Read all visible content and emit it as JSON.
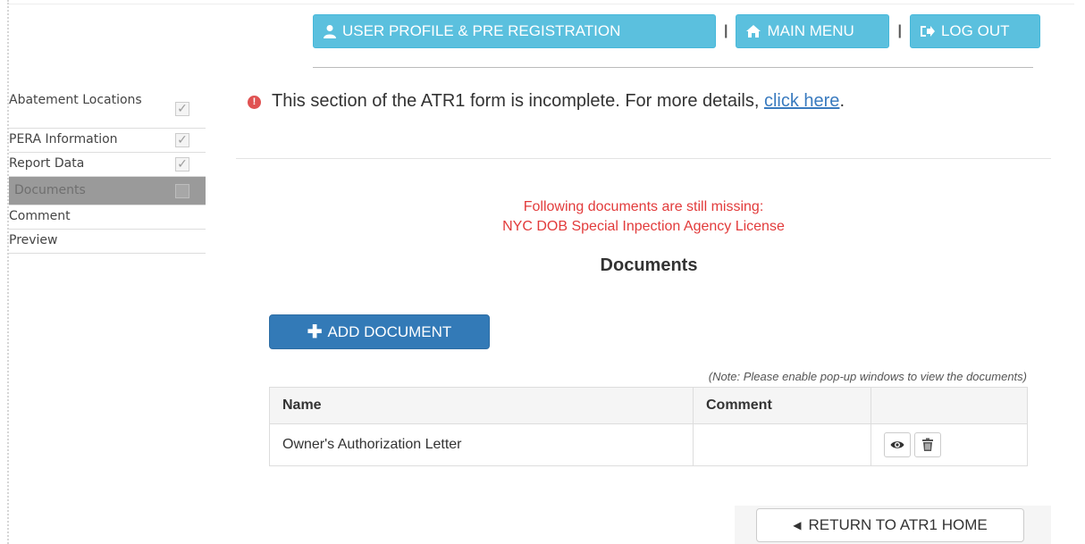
{
  "nav": {
    "profile_label": "USER PROFILE & PRE REGISTRATION",
    "main_menu_label": "MAIN MENU",
    "logout_label": "LOG OUT",
    "separator": "|",
    "button_color": "#5bc0de"
  },
  "sidebar": {
    "items": [
      {
        "label": "Abatement Locations",
        "checked": true
      },
      {
        "label": "PERA Information",
        "checked": true
      },
      {
        "label": "Report Data",
        "checked": true
      },
      {
        "label": "Documents",
        "checked": false,
        "active": true
      },
      {
        "label": "Comment"
      },
      {
        "label": "Preview"
      }
    ],
    "check_mark": "✓"
  },
  "warning": {
    "icon": "!",
    "text": "This section of the ATR1 form is incomplete. For more details, ",
    "link_text": "click here",
    "suffix": "."
  },
  "missing": {
    "line1": "Following documents are still missing:",
    "line2": "NYC DOB Special Inpection Agency License",
    "color": "#e23b3b"
  },
  "documents": {
    "title": "Documents",
    "add_button_label": "ADD DOCUMENT",
    "note": "(Note: Please enable pop-up windows to view the documents)",
    "columns": [
      "Name",
      "Comment",
      ""
    ],
    "rows": [
      {
        "name": "Owner's Authorization Letter",
        "comment": ""
      }
    ]
  },
  "footer": {
    "return_label": "RETURN TO ATR1 HOME"
  }
}
